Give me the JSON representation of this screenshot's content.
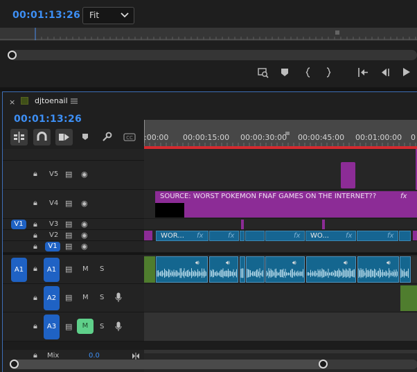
{
  "monitor": {
    "timecode": "00:01:13:26",
    "zoom_select": "Fit",
    "icons": [
      "export-frame-icon",
      "add-marker-icon",
      "mark-in-icon",
      "mark-out-icon",
      "go-to-in-icon",
      "step-back-icon",
      "play-icon"
    ]
  },
  "timeline": {
    "sequence_name": "djtoenail",
    "timecode": "00:01:13:26",
    "tools": [
      "insert-nest-icon",
      "snap-icon",
      "linked-selection-icon",
      "add-marker-icon",
      "settings-wrench-icon",
      "captions-icon"
    ],
    "ruler_labels": [
      ":00:00",
      "00:00:15:00",
      "00:00:30:00",
      "00:00:45:00",
      "00:01:00:00",
      "0"
    ],
    "video_tracks": [
      {
        "name": "V5"
      },
      {
        "name": "V4"
      },
      {
        "name": "V3",
        "source_patch": "V1"
      },
      {
        "name": "V2"
      },
      {
        "name": "V1",
        "highlighted": true
      }
    ],
    "audio_tracks": [
      {
        "name": "A1",
        "source_patch": "A1",
        "mute": "M",
        "solo": "S"
      },
      {
        "name": "A2",
        "mute": "M",
        "solo": "S"
      },
      {
        "name": "A3",
        "mute": "M",
        "solo": "S",
        "mute_active": true
      }
    ],
    "mix": {
      "label": "Mix",
      "value": "0.0"
    },
    "clips": {
      "v4_title": "SOURCE: WORST POKEMON FNAF GAMES ON THE INTERNET??",
      "v4_fx": "fx",
      "v2_clip1": "WOR...",
      "v2_clip2": "WO...",
      "fx": "fx"
    },
    "colors": {
      "accent": "#3d8ff5",
      "track_badge": "#1f62c4",
      "mute_active": "#5fd08a",
      "clip_purple": "#8c2c96",
      "clip_blue": "#166592",
      "playhead": "#e0282d"
    }
  }
}
